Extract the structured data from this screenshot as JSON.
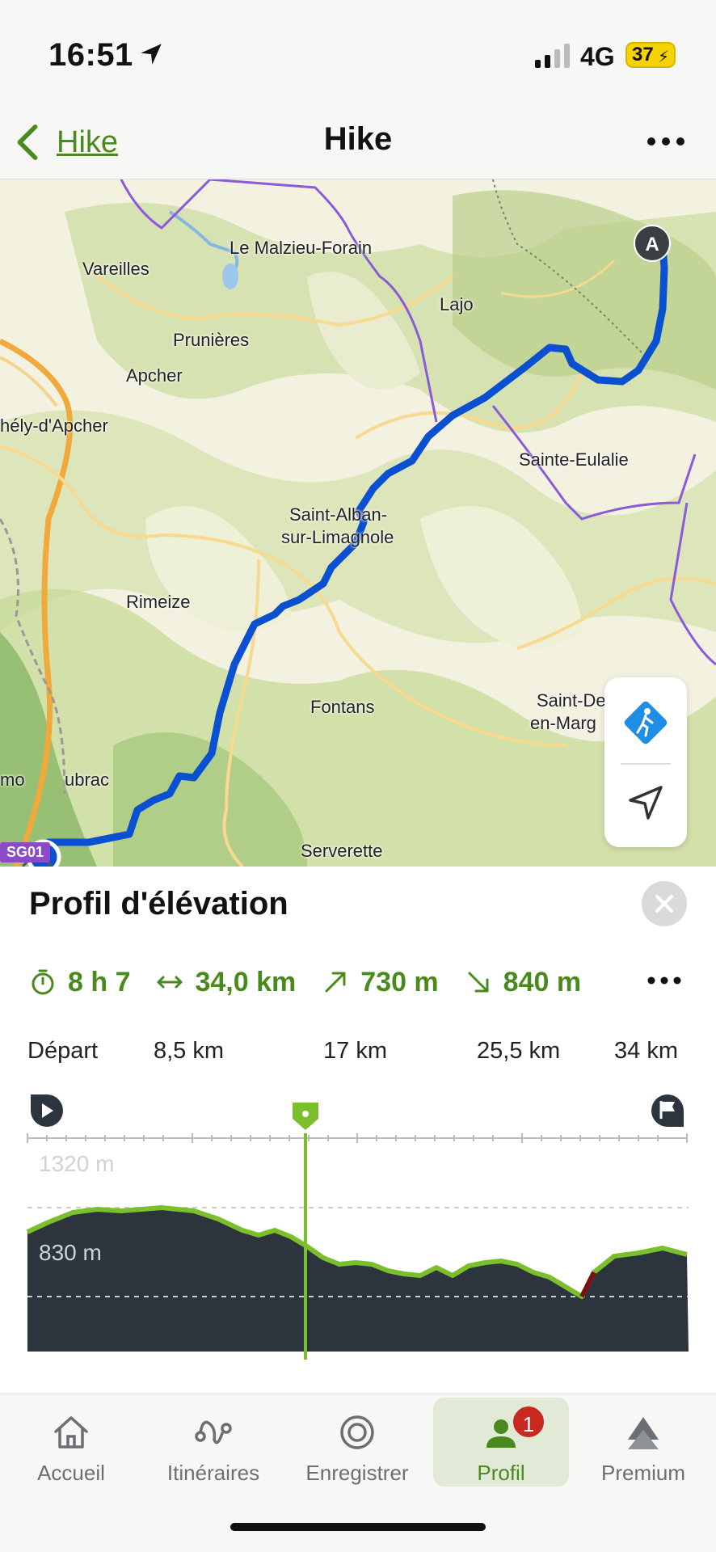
{
  "status_bar": {
    "time": "16:51",
    "network": "4G",
    "battery": "37"
  },
  "nav": {
    "back_label": "Hike",
    "title": "Hike"
  },
  "map": {
    "places": [
      {
        "name": "Le Malzieu-Forain"
      },
      {
        "name": "Vareilles"
      },
      {
        "name": "Lajo"
      },
      {
        "name": "Prunières"
      },
      {
        "name": "Apcher"
      },
      {
        "name": "hély-d'Apcher"
      },
      {
        "name": "Sainte-Eulalie"
      },
      {
        "name": "Saint-Alban-"
      },
      {
        "name": "sur-Limagnole"
      },
      {
        "name": "Rimeize"
      },
      {
        "name": "Fontans"
      },
      {
        "name": "Saint-De"
      },
      {
        "name": "en-Marg"
      },
      {
        "name": "Serverette"
      },
      {
        "name": "mo"
      },
      {
        "name": "ubrac"
      }
    ],
    "start_marker": "A",
    "route_badge": "SG01",
    "route_color": "#0a50d0"
  },
  "elevation": {
    "title": "Profil d'élévation",
    "stats": {
      "duration": "8 h 7",
      "distance": "34,0 km",
      "ascent": "730 m",
      "descent": "840 m"
    },
    "distance_ticks": [
      "Départ",
      "8,5 km",
      "17 km",
      "25,5 km",
      "34 km"
    ],
    "elevation_ticks": [
      "1320 m",
      "830 m"
    ],
    "accent_color": "#7cbf2c",
    "fill_color": "#2c353e"
  },
  "tabs": [
    {
      "label": "Accueil",
      "icon": "home-icon"
    },
    {
      "label": "Itinéraires",
      "icon": "route-icon"
    },
    {
      "label": "Enregistrer",
      "icon": "record-icon"
    },
    {
      "label": "Profil",
      "icon": "profile-icon",
      "badge": "1",
      "active": true
    },
    {
      "label": "Premium",
      "icon": "premium-icon"
    }
  ]
}
